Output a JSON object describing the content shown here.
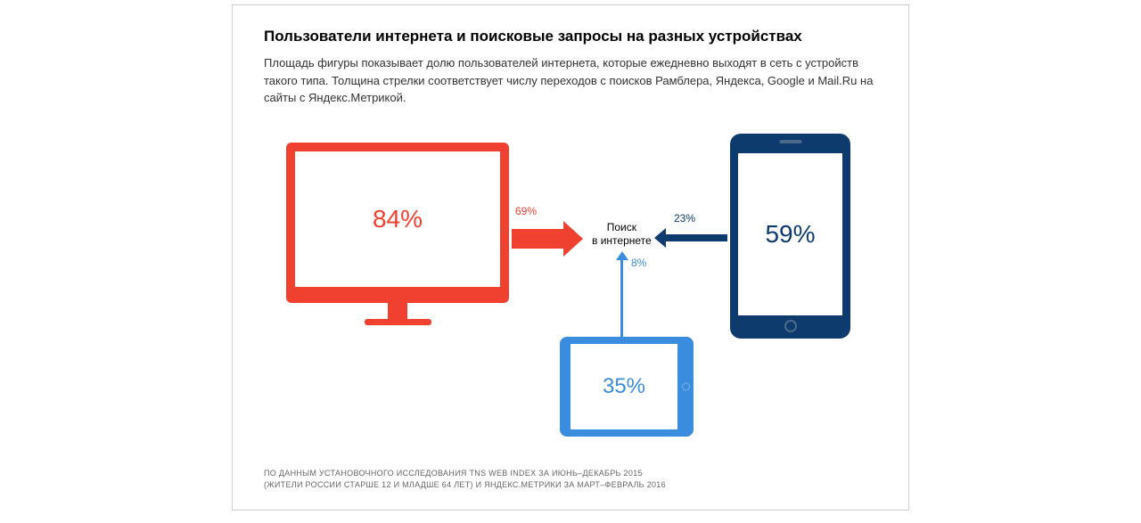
{
  "title": "Пользователи интернета и поисковые запросы на разных устройствах",
  "subtitle": "Площадь фигуры показывает долю пользователей интернета, которые ежедневно выходят в сеть с устройств такого типа. Толщина стрелки соответствует числу переходов с поисков Рамблера, Яндекса, Google и Mail.Ru на сайты с Яндекс.Метрикой.",
  "center_label_line1": "Поиск",
  "center_label_line2": "в интернете",
  "devices": {
    "desktop": {
      "value": "84%",
      "arrow_label": "69%",
      "color": "#ef4030"
    },
    "phone": {
      "value": "59%",
      "arrow_label": "23%",
      "color": "#0e3b6e"
    },
    "tablet": {
      "value": "35%",
      "arrow_label": "8%",
      "color": "#3a8dde"
    }
  },
  "footnote_line1": "ПО ДАННЫМ УСТАНОВОЧНОГО ИССЛЕДОВАНИЯ TNS WEB INDEX ЗА ИЮНЬ–ДЕКАБРЬ 2015",
  "footnote_line2": "(ЖИТЕЛИ РОССИИ СТАРШЕ 12 И МЛАДШЕ 64 ЛЕТ) И ЯНДЕКС.МЕТРИКИ ЗА МАРТ–ФЕВРАЛЬ 2016",
  "chart_data": {
    "type": "diagram",
    "title": "Пользователи интернета и поисковые запросы на разных устройствах",
    "center_node": "Поиск в интернете",
    "nodes": [
      {
        "device": "desktop",
        "daily_user_share_pct": 84,
        "search_transition_share_pct": 69
      },
      {
        "device": "phone",
        "daily_user_share_pct": 59,
        "search_transition_share_pct": 23
      },
      {
        "device": "tablet",
        "daily_user_share_pct": 35,
        "search_transition_share_pct": 8
      }
    ]
  }
}
